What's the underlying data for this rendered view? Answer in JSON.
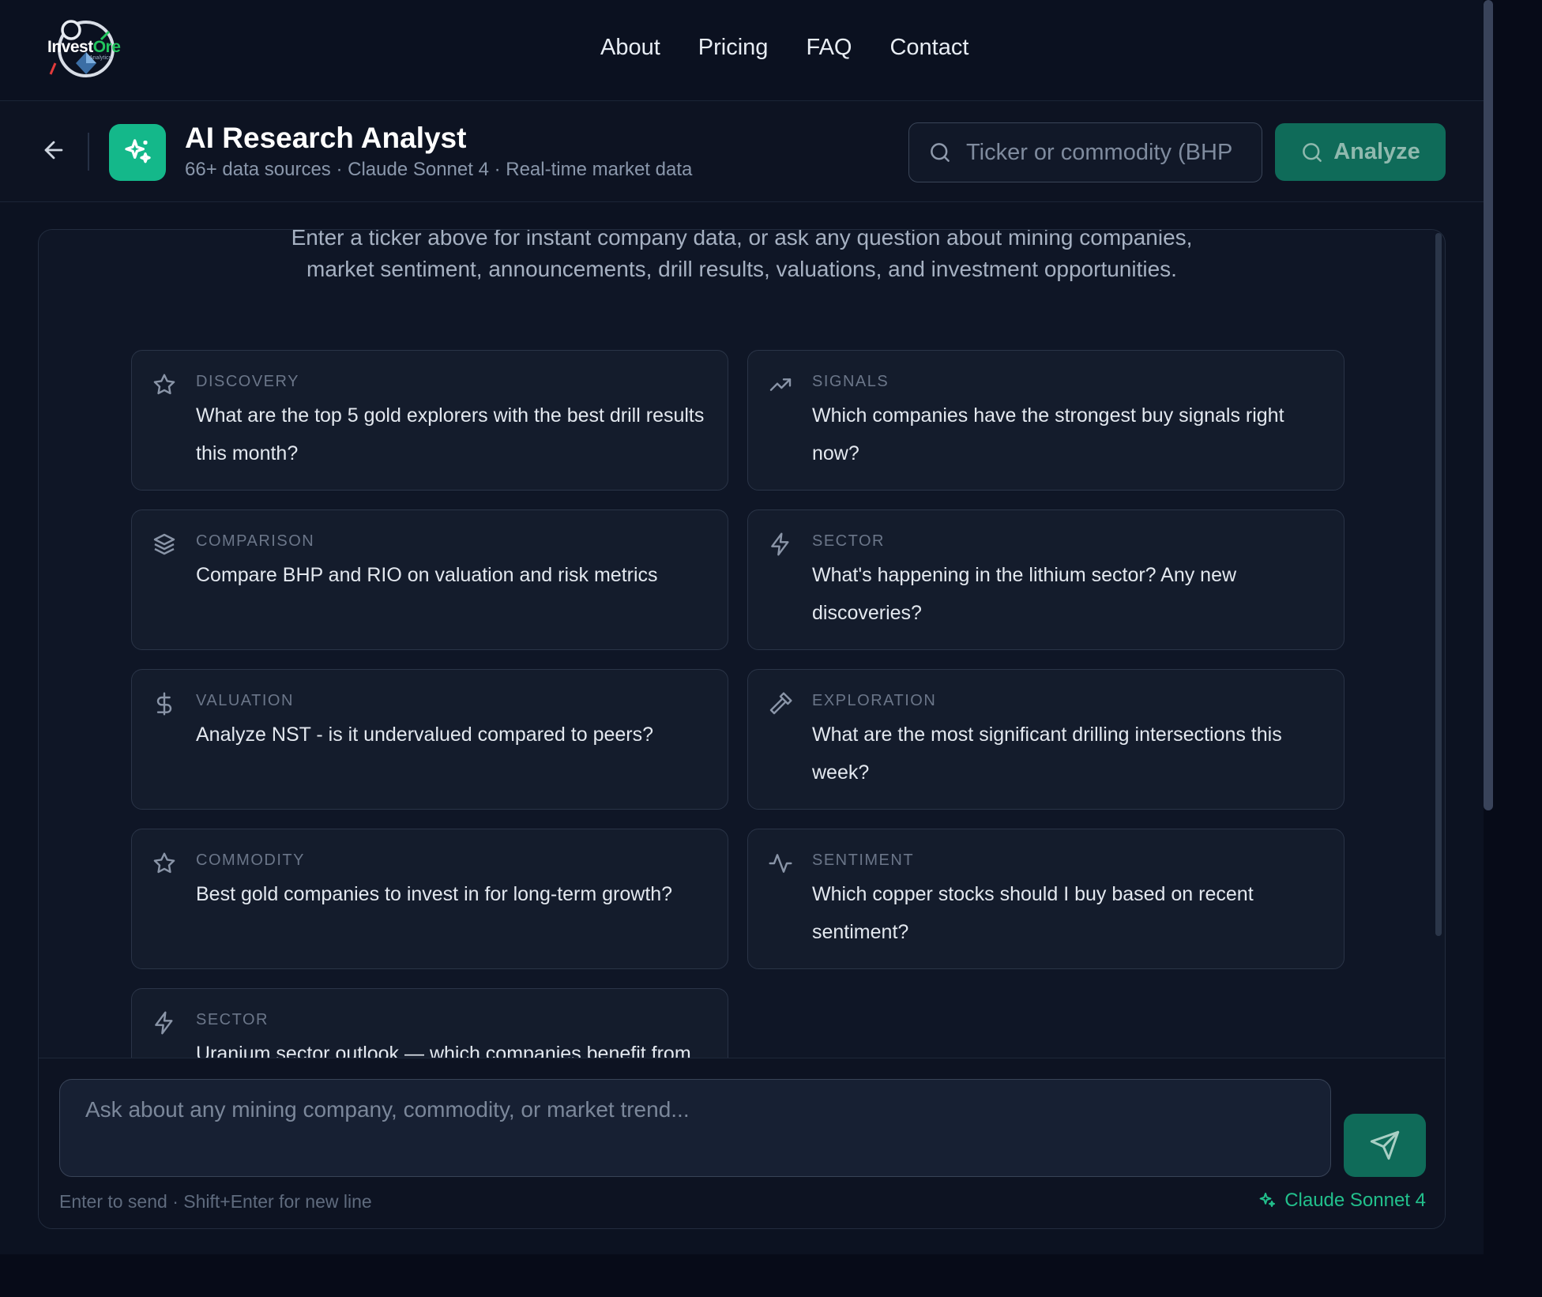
{
  "brand": {
    "name_a": "Invest",
    "name_b": "Ore",
    "sub": "Analytics"
  },
  "nav": {
    "items": [
      {
        "label": "About"
      },
      {
        "label": "Pricing"
      },
      {
        "label": "FAQ"
      },
      {
        "label": "Contact"
      }
    ]
  },
  "header": {
    "title": "AI Research Analyst",
    "subtitle": "66+ data sources · Claude Sonnet 4 · Real-time market data",
    "search_placeholder": "Ticker or commodity (BHP",
    "analyze_label": "Analyze"
  },
  "chat": {
    "intro": "Enter a ticker above for instant company data, or ask any question about mining companies, market sentiment, announcements, drill results, valuations, and investment opportunities.",
    "suggestions": [
      {
        "category": "DISCOVERY",
        "question": "What are the top 5 gold explorers with the best drill results this month?",
        "icon": "star-icon"
      },
      {
        "category": "SIGNALS",
        "question": "Which companies have the strongest buy signals right now?",
        "icon": "trending-up-icon"
      },
      {
        "category": "COMPARISON",
        "question": "Compare BHP and RIO on valuation and risk metrics",
        "icon": "layers-icon"
      },
      {
        "category": "SECTOR",
        "question": "What's happening in the lithium sector? Any new discoveries?",
        "icon": "lightning-icon"
      },
      {
        "category": "VALUATION",
        "question": "Analyze NST - is it undervalued compared to peers?",
        "icon": "dollar-icon"
      },
      {
        "category": "EXPLORATION",
        "question": "What are the most significant drilling intersections this week?",
        "icon": "hammer-icon"
      },
      {
        "category": "COMMODITY",
        "question": "Best gold companies to invest in for long-term growth?",
        "icon": "star-icon"
      },
      {
        "category": "SENTIMENT",
        "question": "Which copper stocks should I buy based on recent sentiment?",
        "icon": "pulse-icon"
      },
      {
        "category": "SECTOR",
        "question": "Uranium sector outlook — which companies benefit from",
        "icon": "lightning-icon"
      }
    ],
    "input_placeholder": "Ask about any mining company, commodity, or market trend...",
    "hint": "Enter to send · Shift+Enter for new line",
    "model": "Claude Sonnet 4"
  },
  "colors": {
    "accent": "#14b88a",
    "button": "#0f6b59",
    "model_text": "#22c08c",
    "background": "#0c1221"
  }
}
